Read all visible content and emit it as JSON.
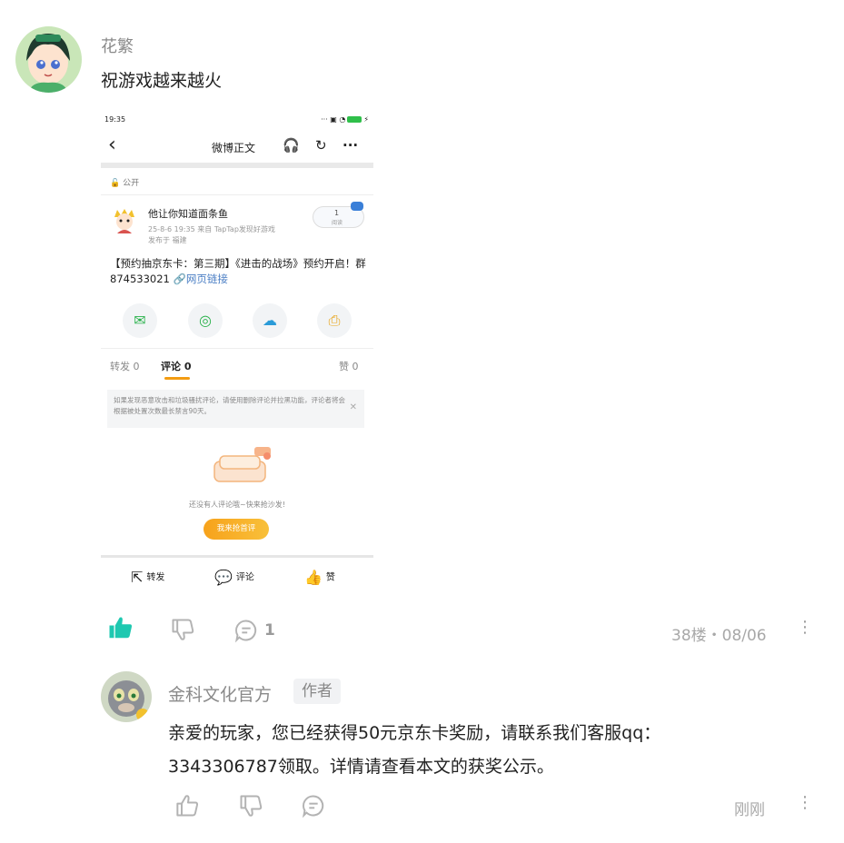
{
  "comment": {
    "username": "花繁",
    "text": "祝游戏越来越火",
    "reply_count": "1",
    "floor_date": "38楼・08/06"
  },
  "screenshot": {
    "status_time": "19:35",
    "status_battery": "100",
    "nav_title": "微博正文",
    "visibility": "公开",
    "post": {
      "author": "他让你知道面条鱼",
      "meta_line1": "25-8-6 19:35  来自 TapTap发现好游戏",
      "meta_line2": "发布于 福建",
      "read_count": "1",
      "read_label": "阅读",
      "body": "【预约抽京东卡：第三期】《进击的战场》预约开启！群874533021",
      "link_text": "网页链接"
    },
    "tabs": {
      "repost": "转发 0",
      "comment": "评论 0",
      "like": "赞 0"
    },
    "notice": "如果发现恶意攻击和垃圾骚扰评论，请使用删除评论并拉黑功能，评论者将会根据被处置次数最长禁言90天。",
    "empty_text": "还没有人评论哦~快来抢沙发!",
    "empty_button": "我来抢首评",
    "actions": {
      "repost": "转发",
      "comment": "评论",
      "like": "赞"
    }
  },
  "reply": {
    "username": "金科文化官方",
    "badge": "作者",
    "text": "亲爱的玩家，您已经获得50元京东卡奖励，请联系我们客服qq：3343306787领取。详情请查看本文的获奖公示。",
    "time": "刚刚"
  },
  "colors": {
    "like_active": "#1ec8b0",
    "icon_gray": "#b3b3b3",
    "button_orange": "#f7a21b",
    "link_blue": "#4a7ec4"
  }
}
